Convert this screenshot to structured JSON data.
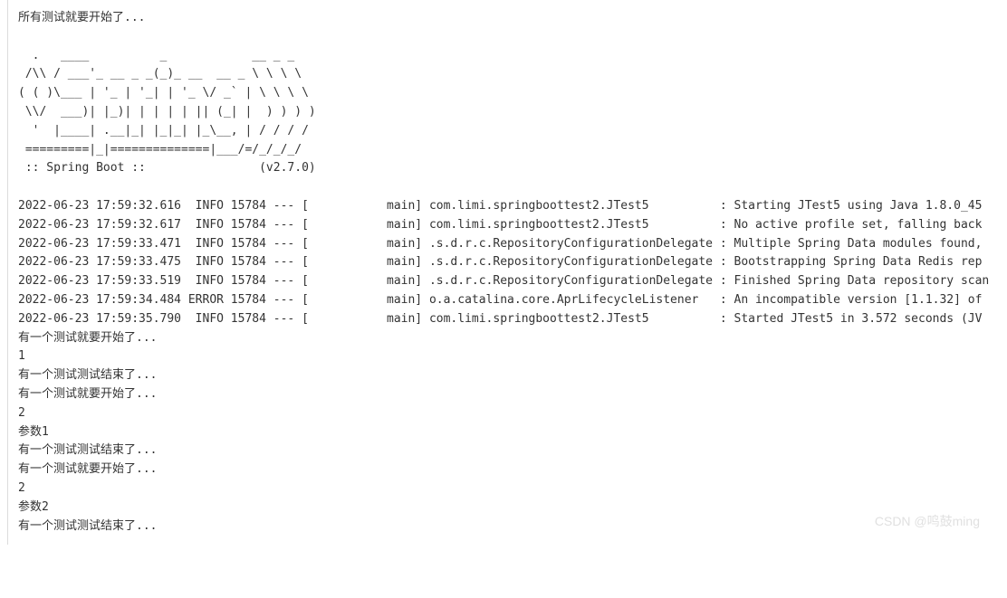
{
  "intro": "所有测试就要开始了...",
  "banner": [
    "  .   ____          _            __ _ _",
    " /\\\\ / ___'_ __ _ _(_)_ __  __ _ \\ \\ \\ \\",
    "( ( )\\___ | '_ | '_| | '_ \\/ _` | \\ \\ \\ \\",
    " \\\\/  ___)| |_)| | | | | || (_| |  ) ) ) )",
    "  '  |____| .__|_| |_|_| |_\\__, | / / / /",
    " =========|_|==============|___/=/_/_/_/",
    " :: Spring Boot ::                (v2.7.0)"
  ],
  "logs": [
    {
      "ts": "2022-06-23 17:59:32.616",
      "level": "INFO",
      "pid": "15784",
      "thread": "main",
      "logger": "com.limi.springboottest2.JTest5",
      "msg": "Starting JTest5 using Java 1.8.0_45"
    },
    {
      "ts": "2022-06-23 17:59:32.617",
      "level": "INFO",
      "pid": "15784",
      "thread": "main",
      "logger": "com.limi.springboottest2.JTest5",
      "msg": "No active profile set, falling back"
    },
    {
      "ts": "2022-06-23 17:59:33.471",
      "level": "INFO",
      "pid": "15784",
      "thread": "main",
      "logger": ".s.d.r.c.RepositoryConfigurationDelegate",
      "msg": "Multiple Spring Data modules found,"
    },
    {
      "ts": "2022-06-23 17:59:33.475",
      "level": "INFO",
      "pid": "15784",
      "thread": "main",
      "logger": ".s.d.r.c.RepositoryConfigurationDelegate",
      "msg": "Bootstrapping Spring Data Redis rep"
    },
    {
      "ts": "2022-06-23 17:59:33.519",
      "level": "INFO",
      "pid": "15784",
      "thread": "main",
      "logger": ".s.d.r.c.RepositoryConfigurationDelegate",
      "msg": "Finished Spring Data repository scan"
    },
    {
      "ts": "2022-06-23 17:59:34.484",
      "level": "ERROR",
      "pid": "15784",
      "thread": "main",
      "logger": "o.a.catalina.core.AprLifecycleListener",
      "msg": "An incompatible version [1.1.32] of"
    },
    {
      "ts": "2022-06-23 17:59:35.790",
      "level": "INFO",
      "pid": "15784",
      "thread": "main",
      "logger": "com.limi.springboottest2.JTest5",
      "msg": "Started JTest5 in 3.572 seconds (JV"
    }
  ],
  "output": [
    "有一个测试就要开始了...",
    "1",
    "有一个测试测试结束了...",
    "有一个测试就要开始了...",
    "2",
    "参数1",
    "有一个测试测试结束了...",
    "有一个测试就要开始了...",
    "2",
    "参数2",
    "有一个测试测试结束了..."
  ],
  "watermark": "CSDN @鸣鼓ming"
}
